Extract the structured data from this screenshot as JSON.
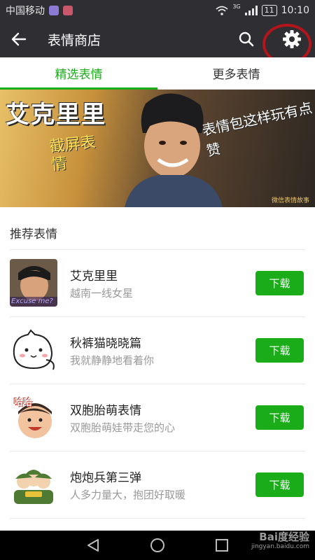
{
  "status_bar": {
    "carrier": "中国移动",
    "network": "3G",
    "battery": "11",
    "time": "10:10"
  },
  "header": {
    "title": "表情商店"
  },
  "tabs": [
    {
      "label": "精选表情",
      "active": true
    },
    {
      "label": "更多表情",
      "active": false
    }
  ],
  "banner": {
    "title": "艾克里里",
    "subtitle": "截屏表情",
    "slogan": "表情包这样玩有点赞",
    "watermark": "微信表情故事"
  },
  "section": {
    "title": "推荐表情"
  },
  "items": [
    {
      "name": "艾克里里",
      "desc": "越南一线女星",
      "button": "下载",
      "thumb_caption": "Excuse me?"
    },
    {
      "name": "秋裤猫晓晓篇",
      "desc": "我就静静地看着你",
      "button": "下载"
    },
    {
      "name": "双胞胎萌表情",
      "desc": "双胞胎萌娃带走您的心",
      "button": "下载",
      "thumb_caption": "哈哈"
    },
    {
      "name": "炮炮兵第三弹",
      "desc": "人多力量大，抱团好取暖",
      "button": "下载"
    }
  ],
  "watermark": {
    "brand": "Bai度经验",
    "url": "jingyan.baidu.com"
  },
  "colors": {
    "accent": "#1aad19",
    "header_bg": "#2e2e33",
    "annotation": "#b3151b"
  }
}
